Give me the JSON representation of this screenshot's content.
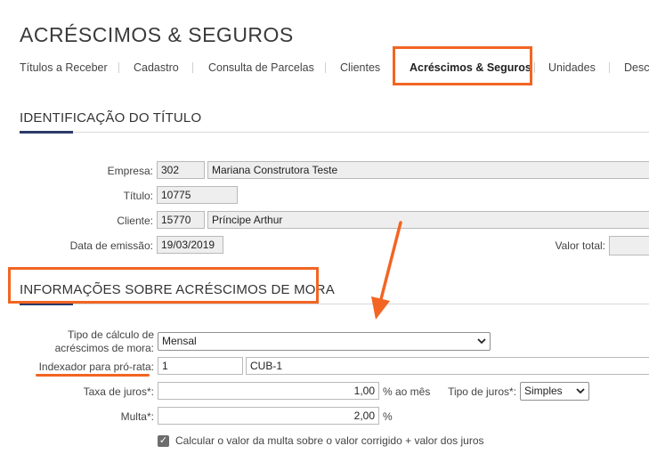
{
  "page": {
    "title": "ACRÉSCIMOS & SEGUROS"
  },
  "tabs": [
    {
      "label": "Títulos a Receber"
    },
    {
      "label": "Cadastro"
    },
    {
      "label": "Consulta de Parcelas"
    },
    {
      "label": "Clientes"
    },
    {
      "label": "Acréscimos & Seguros"
    },
    {
      "label": "Unidades"
    },
    {
      "label": "Desc"
    }
  ],
  "identificacao": {
    "title": "IDENTIFICAÇÃO DO TÍTULO",
    "empresa": {
      "label": "Empresa:",
      "code": "302",
      "name": "Mariana Construtora Teste"
    },
    "titulo": {
      "label": "Título:",
      "value": "10775"
    },
    "cliente": {
      "label": "Cliente:",
      "code": "15770",
      "name": "Príncipe Arthur"
    },
    "data_emissao": {
      "label": "Data de emissão:",
      "value": "19/03/2019"
    },
    "valor_total": {
      "label": "Valor total:",
      "value": ""
    }
  },
  "mora": {
    "title": "INFORMAÇÕES SOBRE ACRÉSCIMOS DE MORA",
    "tipo_calculo": {
      "label_line1": "Tipo de cálculo de",
      "label_line2": "acréscimos de mora:",
      "selected": "Mensal"
    },
    "indexador": {
      "label": "Indexador para pró-rata:",
      "code": "1",
      "name": "CUB-1"
    },
    "taxa_juros": {
      "label": "Taxa de juros*:",
      "value": "1,00",
      "unit": "% ao mês"
    },
    "tipo_juros": {
      "label": "Tipo de juros*:",
      "selected": "Simples"
    },
    "multa": {
      "label": "Multa*:",
      "value": "2,00",
      "unit": "%"
    },
    "calcular_multa": {
      "label": "Calcular o valor da multa sobre o valor corrigido + valor dos juros",
      "checked": true
    }
  },
  "colors": {
    "highlight": "#f26522",
    "accent": "#2b3a67"
  },
  "icons": {
    "arrow": "arrow-annotation-icon",
    "chevron": "chevron-down-icon",
    "check": "checkmark-icon"
  }
}
